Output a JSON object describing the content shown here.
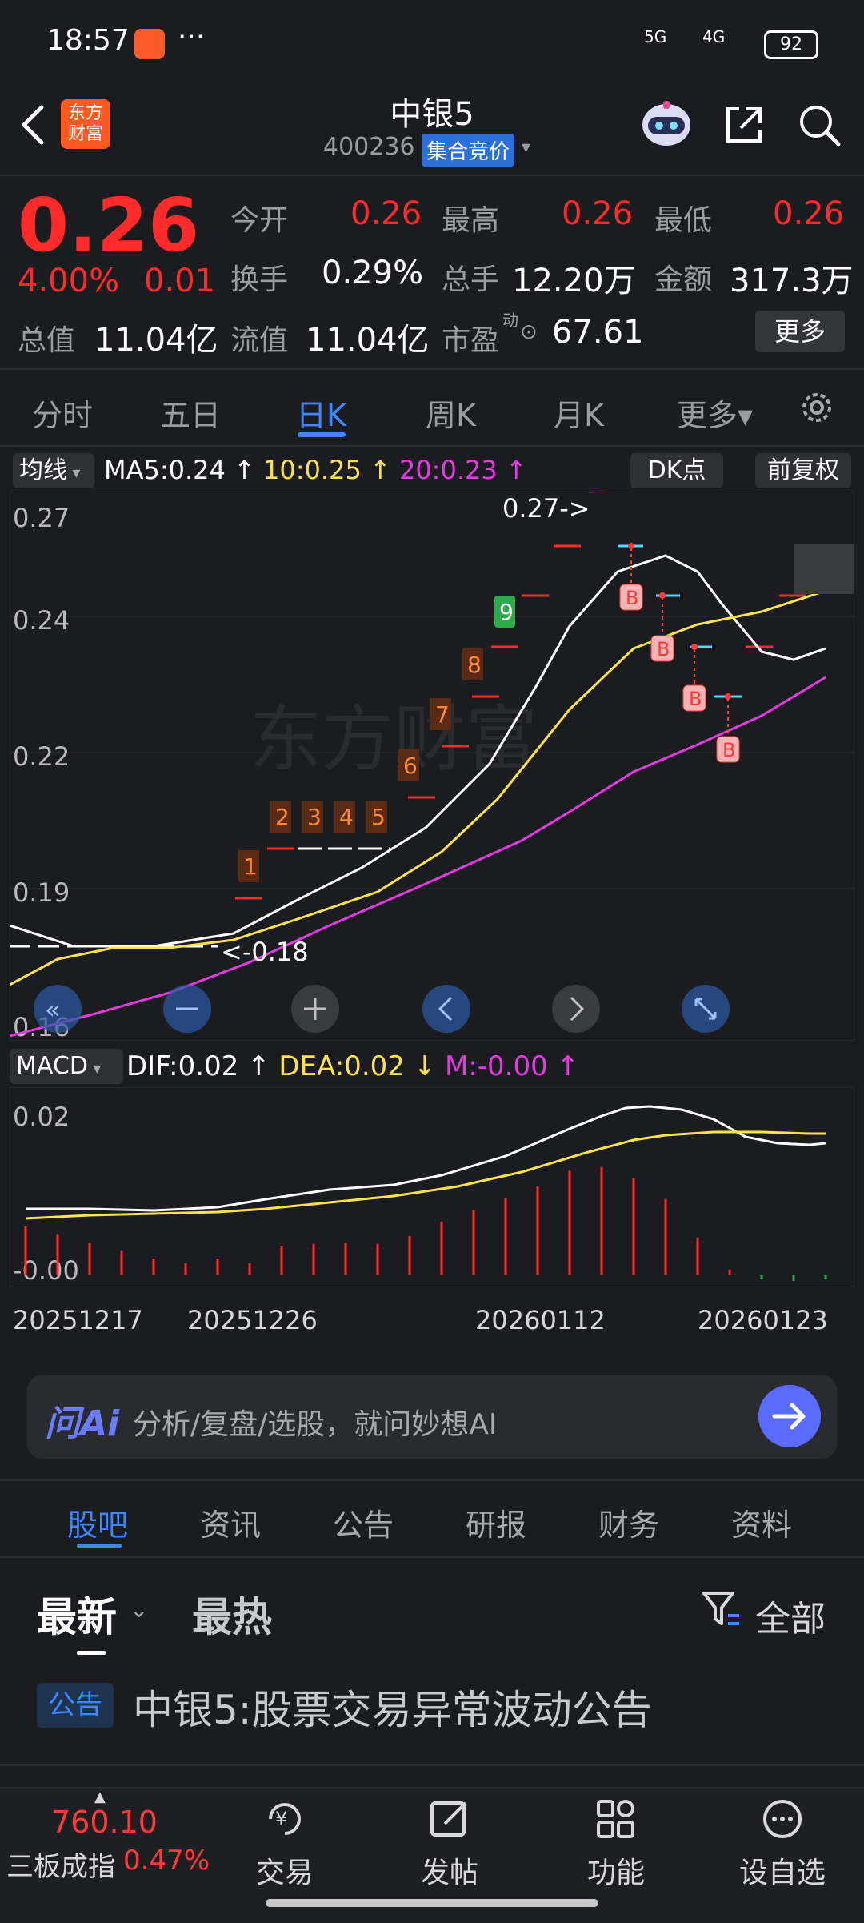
{
  "status_bar": {
    "time": "18:57",
    "dots": "···",
    "signal1": "5G",
    "signal2": "4G",
    "battery": "92"
  },
  "header": {
    "logo_text": "东方财富",
    "stock_name": "中银5",
    "stock_code": "400236",
    "auction_badge": "集合竞价"
  },
  "quote": {
    "price": "0.26",
    "pct_change": "4.00%",
    "change": "0.01",
    "open_label": "今开",
    "open": "0.26",
    "high_label": "最高",
    "high": "0.26",
    "low_label": "最低",
    "low": "0.26",
    "turnover_label": "换手",
    "turnover": "0.29%",
    "volume_label": "总手",
    "volume": "12.20万",
    "amount_label": "金额",
    "amount": "317.3万",
    "mktcap_label": "总值",
    "mktcap": "11.04亿",
    "float_label": "流值",
    "float_cap": "11.04亿",
    "pe_label": "市盈",
    "pe_sup": "动",
    "pe": "67.61",
    "more_button": "更多"
  },
  "tabs": [
    "分时",
    "五日",
    "日K",
    "周K",
    "月K",
    "更多▾"
  ],
  "active_tab": "日K",
  "kline": {
    "ma_button": "均线",
    "ma5": "MA5:0.24 ↑",
    "ma10": "10:0.25 ↑",
    "ma20": "20:0.23 ↑",
    "dk_button": "DK点",
    "adjust_button": "前复权",
    "y_labels": [
      "0.27",
      "0.24",
      "0.22",
      "0.19",
      "0.16"
    ],
    "max_annotation": "0.27->",
    "min_annotation": "<-0.18",
    "seq_numbers": [
      "1",
      "2",
      "3",
      "4",
      "5",
      "6",
      "7",
      "8",
      "9"
    ],
    "buy_marker": "B"
  },
  "macd": {
    "button": "MACD",
    "dif": "DIF:0.02 ↑",
    "dea": "DEA:0.02 ↓",
    "m": "M:-0.00 ↑",
    "y_labels": [
      "0.02",
      "-0.00"
    ]
  },
  "dates": [
    "20251217",
    "20251226",
    "20260112",
    "20260123"
  ],
  "ai": {
    "logo": "问Ai",
    "placeholder": "分析/复盘/选股，就问妙想AI"
  },
  "bottom_tabs": [
    "股吧",
    "资讯",
    "公告",
    "研报",
    "财务",
    "资料"
  ],
  "sort": {
    "latest": "最新",
    "hot": "最热",
    "filter": "全部"
  },
  "notice": {
    "badge": "公告",
    "title": "中银5:股票交易异常波动公告"
  },
  "bottom_nav": {
    "index_value": "760.10",
    "index_name": "三板成指",
    "index_pct": "0.47%",
    "items": [
      "交易",
      "发帖",
      "功能",
      "设自选"
    ]
  },
  "colors": {
    "up": "#ff2a2a",
    "accent": "#3f86ff",
    "ma5": "#ffffff",
    "ma10": "#ffe14d",
    "ma20": "#e23be2"
  }
}
